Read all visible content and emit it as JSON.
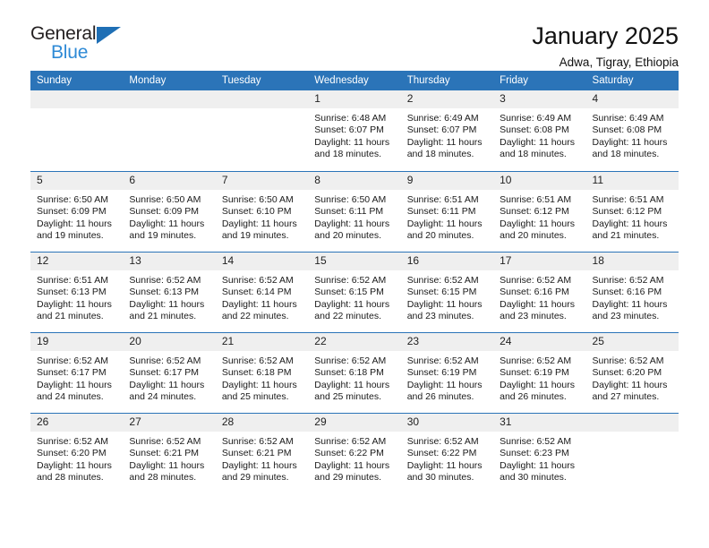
{
  "brand": {
    "name_top": "General",
    "name_bottom": "Blue",
    "triangle_icon": "triangle-icon",
    "accent_color": "#2b74b8",
    "logo_blue": "#2e8ad6"
  },
  "header": {
    "title": "January 2025",
    "subtitle": "Adwa, Tigray, Ethiopia"
  },
  "calendar": {
    "weekday_headers": [
      "Sunday",
      "Monday",
      "Tuesday",
      "Wednesday",
      "Thursday",
      "Friday",
      "Saturday"
    ],
    "weeks": [
      [
        {
          "day": "",
          "lines": []
        },
        {
          "day": "",
          "lines": []
        },
        {
          "day": "",
          "lines": []
        },
        {
          "day": "1",
          "lines": [
            "Sunrise: 6:48 AM",
            "Sunset: 6:07 PM",
            "Daylight: 11 hours",
            "and 18 minutes."
          ]
        },
        {
          "day": "2",
          "lines": [
            "Sunrise: 6:49 AM",
            "Sunset: 6:07 PM",
            "Daylight: 11 hours",
            "and 18 minutes."
          ]
        },
        {
          "day": "3",
          "lines": [
            "Sunrise: 6:49 AM",
            "Sunset: 6:08 PM",
            "Daylight: 11 hours",
            "and 18 minutes."
          ]
        },
        {
          "day": "4",
          "lines": [
            "Sunrise: 6:49 AM",
            "Sunset: 6:08 PM",
            "Daylight: 11 hours",
            "and 18 minutes."
          ]
        }
      ],
      [
        {
          "day": "5",
          "lines": [
            "Sunrise: 6:50 AM",
            "Sunset: 6:09 PM",
            "Daylight: 11 hours",
            "and 19 minutes."
          ]
        },
        {
          "day": "6",
          "lines": [
            "Sunrise: 6:50 AM",
            "Sunset: 6:09 PM",
            "Daylight: 11 hours",
            "and 19 minutes."
          ]
        },
        {
          "day": "7",
          "lines": [
            "Sunrise: 6:50 AM",
            "Sunset: 6:10 PM",
            "Daylight: 11 hours",
            "and 19 minutes."
          ]
        },
        {
          "day": "8",
          "lines": [
            "Sunrise: 6:50 AM",
            "Sunset: 6:11 PM",
            "Daylight: 11 hours",
            "and 20 minutes."
          ]
        },
        {
          "day": "9",
          "lines": [
            "Sunrise: 6:51 AM",
            "Sunset: 6:11 PM",
            "Daylight: 11 hours",
            "and 20 minutes."
          ]
        },
        {
          "day": "10",
          "lines": [
            "Sunrise: 6:51 AM",
            "Sunset: 6:12 PM",
            "Daylight: 11 hours",
            "and 20 minutes."
          ]
        },
        {
          "day": "11",
          "lines": [
            "Sunrise: 6:51 AM",
            "Sunset: 6:12 PM",
            "Daylight: 11 hours",
            "and 21 minutes."
          ]
        }
      ],
      [
        {
          "day": "12",
          "lines": [
            "Sunrise: 6:51 AM",
            "Sunset: 6:13 PM",
            "Daylight: 11 hours",
            "and 21 minutes."
          ]
        },
        {
          "day": "13",
          "lines": [
            "Sunrise: 6:52 AM",
            "Sunset: 6:13 PM",
            "Daylight: 11 hours",
            "and 21 minutes."
          ]
        },
        {
          "day": "14",
          "lines": [
            "Sunrise: 6:52 AM",
            "Sunset: 6:14 PM",
            "Daylight: 11 hours",
            "and 22 minutes."
          ]
        },
        {
          "day": "15",
          "lines": [
            "Sunrise: 6:52 AM",
            "Sunset: 6:15 PM",
            "Daylight: 11 hours",
            "and 22 minutes."
          ]
        },
        {
          "day": "16",
          "lines": [
            "Sunrise: 6:52 AM",
            "Sunset: 6:15 PM",
            "Daylight: 11 hours",
            "and 23 minutes."
          ]
        },
        {
          "day": "17",
          "lines": [
            "Sunrise: 6:52 AM",
            "Sunset: 6:16 PM",
            "Daylight: 11 hours",
            "and 23 minutes."
          ]
        },
        {
          "day": "18",
          "lines": [
            "Sunrise: 6:52 AM",
            "Sunset: 6:16 PM",
            "Daylight: 11 hours",
            "and 23 minutes."
          ]
        }
      ],
      [
        {
          "day": "19",
          "lines": [
            "Sunrise: 6:52 AM",
            "Sunset: 6:17 PM",
            "Daylight: 11 hours",
            "and 24 minutes."
          ]
        },
        {
          "day": "20",
          "lines": [
            "Sunrise: 6:52 AM",
            "Sunset: 6:17 PM",
            "Daylight: 11 hours",
            "and 24 minutes."
          ]
        },
        {
          "day": "21",
          "lines": [
            "Sunrise: 6:52 AM",
            "Sunset: 6:18 PM",
            "Daylight: 11 hours",
            "and 25 minutes."
          ]
        },
        {
          "day": "22",
          "lines": [
            "Sunrise: 6:52 AM",
            "Sunset: 6:18 PM",
            "Daylight: 11 hours",
            "and 25 minutes."
          ]
        },
        {
          "day": "23",
          "lines": [
            "Sunrise: 6:52 AM",
            "Sunset: 6:19 PM",
            "Daylight: 11 hours",
            "and 26 minutes."
          ]
        },
        {
          "day": "24",
          "lines": [
            "Sunrise: 6:52 AM",
            "Sunset: 6:19 PM",
            "Daylight: 11 hours",
            "and 26 minutes."
          ]
        },
        {
          "day": "25",
          "lines": [
            "Sunrise: 6:52 AM",
            "Sunset: 6:20 PM",
            "Daylight: 11 hours",
            "and 27 minutes."
          ]
        }
      ],
      [
        {
          "day": "26",
          "lines": [
            "Sunrise: 6:52 AM",
            "Sunset: 6:20 PM",
            "Daylight: 11 hours",
            "and 28 minutes."
          ]
        },
        {
          "day": "27",
          "lines": [
            "Sunrise: 6:52 AM",
            "Sunset: 6:21 PM",
            "Daylight: 11 hours",
            "and 28 minutes."
          ]
        },
        {
          "day": "28",
          "lines": [
            "Sunrise: 6:52 AM",
            "Sunset: 6:21 PM",
            "Daylight: 11 hours",
            "and 29 minutes."
          ]
        },
        {
          "day": "29",
          "lines": [
            "Sunrise: 6:52 AM",
            "Sunset: 6:22 PM",
            "Daylight: 11 hours",
            "and 29 minutes."
          ]
        },
        {
          "day": "30",
          "lines": [
            "Sunrise: 6:52 AM",
            "Sunset: 6:22 PM",
            "Daylight: 11 hours",
            "and 30 minutes."
          ]
        },
        {
          "day": "31",
          "lines": [
            "Sunrise: 6:52 AM",
            "Sunset: 6:23 PM",
            "Daylight: 11 hours",
            "and 30 minutes."
          ]
        },
        {
          "day": "",
          "lines": []
        }
      ]
    ]
  }
}
